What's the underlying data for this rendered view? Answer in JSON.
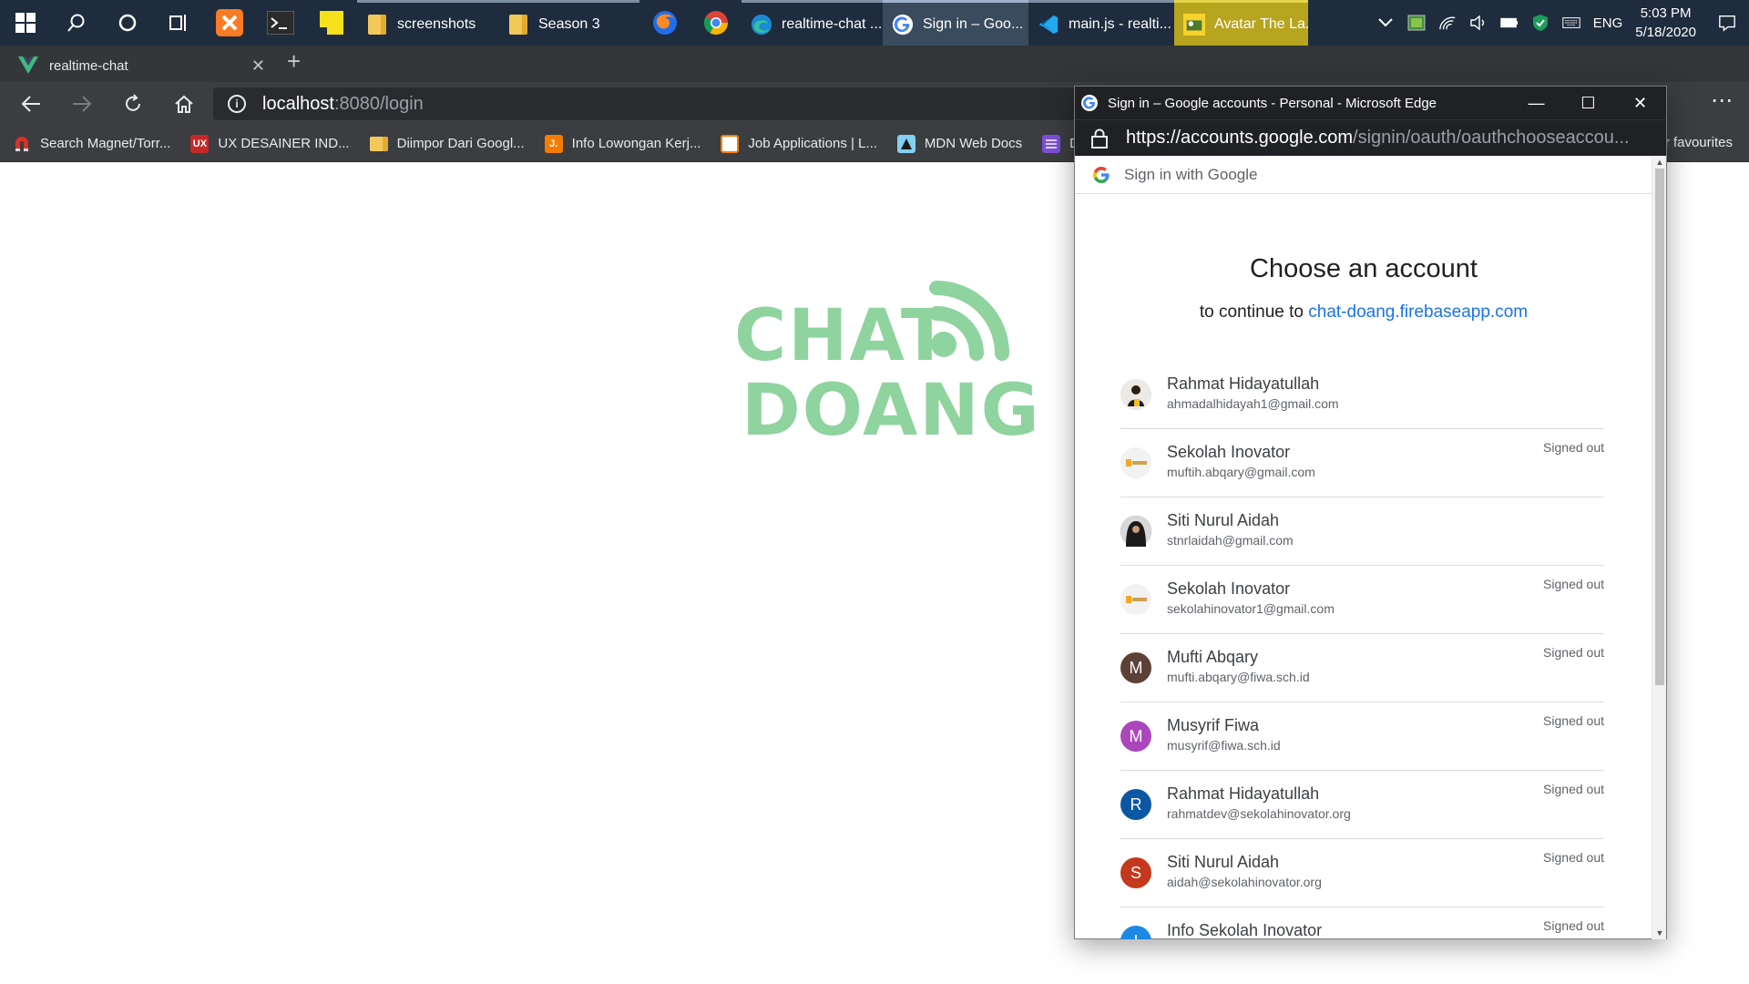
{
  "taskbar": {
    "tasks": [
      {
        "label": "screenshots",
        "icon": "folder-icon"
      },
      {
        "label": "Season 3",
        "icon": "folder-icon"
      },
      {
        "label": "realtime-chat ...",
        "icon": "edge-icon"
      },
      {
        "label": "Sign in – Goo...",
        "icon": "google-icon"
      },
      {
        "label": "main.js - realti...",
        "icon": "vscode-icon"
      },
      {
        "label": "Avatar The La...",
        "icon": "image-icon"
      }
    ],
    "language": "ENG",
    "time": "5:03 PM",
    "date": "5/18/2020"
  },
  "browser": {
    "tab_title": "realtime-chat",
    "url_host": "localhost",
    "url_path": ":8080/login",
    "bookmarks": [
      {
        "label": "Search Magnet/Torr...",
        "icon": "magnet-icon",
        "color": "#d93025"
      },
      {
        "label": "UX DESAINER IND...",
        "icon": "ux-icon",
        "color": "#c62828",
        "glyph": "UX"
      },
      {
        "label": "Diimpor Dari Googl...",
        "icon": "folder-icon",
        "color": "#f3c85a"
      },
      {
        "label": "Info Lowongan Kerj...",
        "icon": "jobs-icon",
        "color": "#f57c00",
        "glyph": "J."
      },
      {
        "label": "Job Applications | L...",
        "icon": "document-icon",
        "color": "#ffffff"
      },
      {
        "label": "MDN Web Docs",
        "icon": "mdn-icon",
        "color": "#83d0f2"
      },
      {
        "label": "Da",
        "icon": "list-icon",
        "color": "#7b4fd6"
      }
    ],
    "bookmarks_overflow": "r favourites"
  },
  "page": {
    "logo_line1": "CHAT",
    "logo_line2": "DOANG",
    "logo_color": "#8fd39f"
  },
  "popup": {
    "window_title": "Sign in – Google accounts - Personal - Microsoft Edge",
    "url_scheme": "https://",
    "url_domain": "accounts.google.com",
    "url_rest": "/signin/oauth/oauthchooseaccou...",
    "signin_header": "Sign in with Google",
    "heading": "Choose an account",
    "continue_prefix": "to continue to ",
    "continue_link": "chat-doang.firebaseapp.com",
    "accounts": [
      {
        "name": "Rahmat Hidayatullah",
        "email": "ahmadalhidayah1@gmail.com",
        "status": "",
        "avatar": "photo",
        "color": "#e0e0e0"
      },
      {
        "name": "Sekolah Inovator",
        "email": "muftih.abqary@gmail.com",
        "status": "Signed out",
        "avatar": "logo",
        "color": "#f0f0f0"
      },
      {
        "name": "Siti Nurul Aidah",
        "email": "stnrlaidah@gmail.com",
        "status": "",
        "avatar": "photo",
        "color": "#2b2b2b"
      },
      {
        "name": "Sekolah Inovator",
        "email": "sekolahinovator1@gmail.com",
        "status": "Signed out",
        "avatar": "logo",
        "color": "#f0f0f0"
      },
      {
        "name": "Mufti Abqary",
        "email": "mufti.abqary@fiwa.sch.id",
        "status": "Signed out",
        "avatar": "M",
        "color": "#5d4037"
      },
      {
        "name": "Musyrif Fiwa",
        "email": "musyrif@fiwa.sch.id",
        "status": "Signed out",
        "avatar": "M",
        "color": "#ab47bc"
      },
      {
        "name": "Rahmat Hidayatullah",
        "email": "rahmatdev@sekolahinovator.org",
        "status": "Signed out",
        "avatar": "R",
        "color": "#0b57a4"
      },
      {
        "name": "Siti Nurul Aidah",
        "email": "aidah@sekolahinovator.org",
        "status": "Signed out",
        "avatar": "S",
        "color": "#c4391d"
      },
      {
        "name": "Info Sekolah Inovator",
        "email": "",
        "status": "Signed out",
        "avatar": "I",
        "color": "#1e88e5"
      }
    ]
  }
}
